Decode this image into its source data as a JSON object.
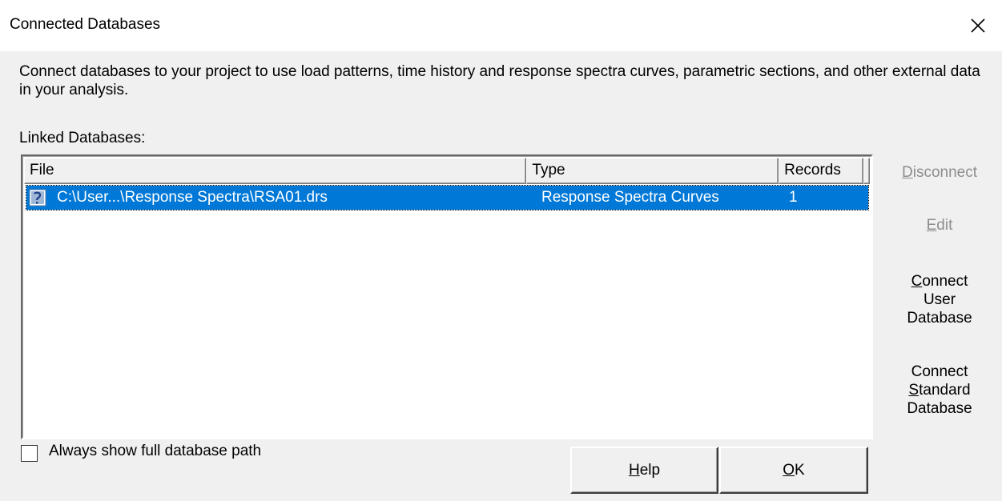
{
  "window": {
    "title": "Connected Databases",
    "close_icon": "close-icon"
  },
  "intro": {
    "text": "Connect databases to your project to use load patterns, time history and response spectra curves, parametric sections, and other external data in your analysis."
  },
  "linked_databases": {
    "label": "Linked Databases:",
    "columns": [
      "File",
      "Type",
      "Records"
    ],
    "rows": [
      {
        "icon": "database-file-icon",
        "file": "C:\\User...\\Response Spectra\\RSA01.drs",
        "type": "Response Spectra Curves",
        "records": "1",
        "selected": true
      }
    ]
  },
  "side_buttons": {
    "disconnect": {
      "accel": "D",
      "rest": "isconnect",
      "enabled": false
    },
    "edit": {
      "accel": "E",
      "rest": "dit",
      "enabled": false
    },
    "connect_user": {
      "line1_accel": "C",
      "line1_rest": "onnect",
      "line2": "User",
      "line3": "Database",
      "enabled": true
    },
    "connect_standard": {
      "line1": "Connect",
      "line2_accel": "S",
      "line2_rest": "tandard",
      "line3": "Database",
      "enabled": true
    }
  },
  "options": {
    "show_full_path_label": "Always show full database path",
    "show_full_path_checked": false
  },
  "buttons": {
    "help_accel": "H",
    "help_rest": "elp",
    "ok_accel": "O",
    "ok_rest": "K"
  },
  "colors": {
    "selection": "#0078d7",
    "disabled_text": "#8d8d8d",
    "dialog_bg": "#f0f0f0"
  }
}
